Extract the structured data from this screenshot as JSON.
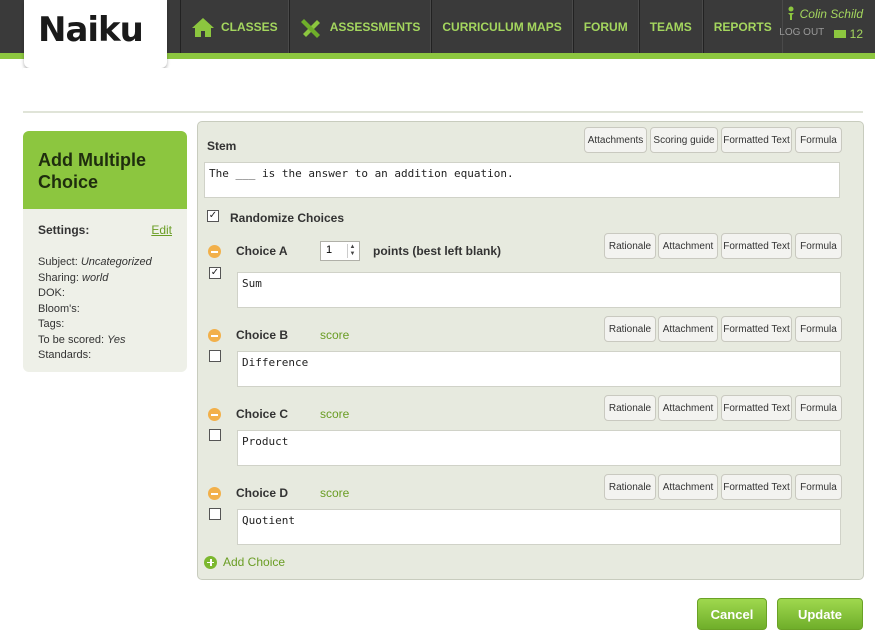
{
  "app": {
    "logo": "Naiku"
  },
  "nav": [
    {
      "label": "CLASSES",
      "icon": "house-icon"
    },
    {
      "label": "ASSESSMENTS",
      "icon": "pencil-ruler-icon"
    },
    {
      "label": "CURRICULUM MAPS"
    },
    {
      "label": "FORUM"
    },
    {
      "label": "TEAMS"
    },
    {
      "label": "REPORTS"
    }
  ],
  "user": {
    "name": "Colin Schild",
    "logout": "LOG OUT",
    "notification_count": "12"
  },
  "side": {
    "title_line1": "Add Multiple",
    "title_line2": "Choice",
    "settings_label": "Settings:",
    "edit_label": "Edit",
    "subject_label": "Subject:",
    "subject_value": "Uncategorized",
    "sharing_label": "Sharing:",
    "sharing_value": "world",
    "dok_label": "DOK:",
    "blooms_label": "Bloom's:",
    "tags_label": "Tags:",
    "scored_label": "To be scored:",
    "scored_value": "Yes",
    "standards_label": "Standards:"
  },
  "stem": {
    "label": "Stem",
    "text": "The ___ is the answer to an addition equation.",
    "buttons": [
      "Attachments",
      "Scoring guide",
      "Formatted Text",
      "Formula"
    ]
  },
  "randomize": {
    "label": "Randomize Choices",
    "checked": true
  },
  "choice_buttons": [
    "Rationale",
    "Attachment",
    "Formatted Text",
    "Formula"
  ],
  "choices": [
    {
      "label": "Choice A",
      "text": "Sum",
      "checked": true,
      "points": "1",
      "points_label": "points (best left blank)"
    },
    {
      "label": "Choice B",
      "text": "Difference",
      "checked": false,
      "score_label": "score"
    },
    {
      "label": "Choice C",
      "text": "Product",
      "checked": false,
      "score_label": "score"
    },
    {
      "label": "Choice D",
      "text": "Quotient",
      "checked": false,
      "score_label": "score"
    }
  ],
  "add_choice_label": "Add Choice",
  "actions": {
    "cancel": "Cancel",
    "update": "Update"
  },
  "colors": {
    "accent": "#8cc63f",
    "header": "#3a3a3a",
    "panel": "#e7eadf",
    "remove": "#f2b04a"
  }
}
